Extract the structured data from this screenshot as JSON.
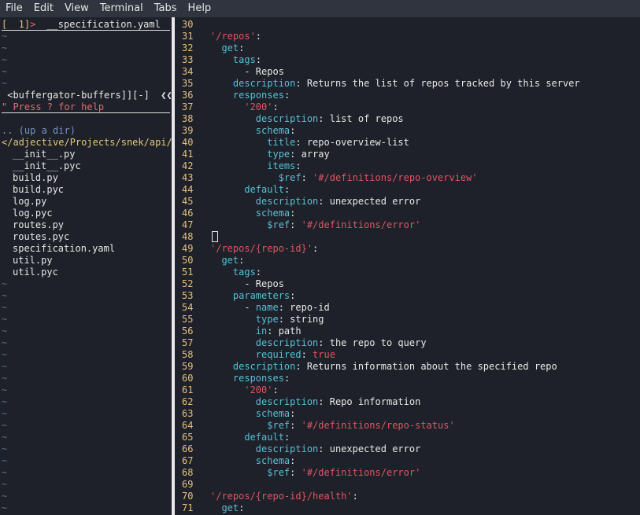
{
  "menu": [
    "File",
    "Edit",
    "View",
    "Terminal",
    "Tabs",
    "Help"
  ],
  "left": {
    "file_tab_bracket": "[  1]",
    "file_tab_arrow": ">",
    "file_tab_name": "__specification.yaml",
    "tilde": "~",
    "buffergator_status": " <buffergator-buffers]][-]  ",
    "buffergator_arrows": "❮❮❮",
    "help_hint": "\" Press ? for help",
    "up_dir": ".. (up a dir)",
    "cwd": "</adjective/Projects/snek/api/",
    "files": [
      "__init__.py",
      "__init__.pyc",
      "build.py",
      "build.pyc",
      "log.py",
      "log.pyc",
      "routes.py",
      "routes.pyc",
      "specification.yaml",
      "util.py",
      "util.pyc"
    ]
  },
  "editor": {
    "lines": [
      {
        "n": "30",
        "indent": "",
        "parts": []
      },
      {
        "n": "31",
        "indent": "",
        "parts": [
          {
            "t": "str",
            "v": "'/repos'"
          },
          {
            "t": "plain",
            "v": ":"
          }
        ]
      },
      {
        "n": "32",
        "indent": "  ",
        "parts": [
          {
            "t": "key",
            "v": "get"
          },
          {
            "t": "plain",
            "v": ":"
          }
        ]
      },
      {
        "n": "33",
        "indent": "    ",
        "parts": [
          {
            "t": "key",
            "v": "tags"
          },
          {
            "t": "plain",
            "v": ":"
          }
        ]
      },
      {
        "n": "34",
        "indent": "      ",
        "parts": [
          {
            "t": "plain",
            "v": "- Repos"
          }
        ]
      },
      {
        "n": "35",
        "indent": "    ",
        "parts": [
          {
            "t": "key",
            "v": "description"
          },
          {
            "t": "plain",
            "v": ": Returns the list of repos tracked by this server"
          }
        ]
      },
      {
        "n": "36",
        "indent": "    ",
        "parts": [
          {
            "t": "key",
            "v": "responses"
          },
          {
            "t": "plain",
            "v": ":"
          }
        ]
      },
      {
        "n": "37",
        "indent": "      ",
        "parts": [
          {
            "t": "str",
            "v": "'200'"
          },
          {
            "t": "plain",
            "v": ":"
          }
        ]
      },
      {
        "n": "38",
        "indent": "        ",
        "parts": [
          {
            "t": "key",
            "v": "description"
          },
          {
            "t": "plain",
            "v": ": list of repos"
          }
        ]
      },
      {
        "n": "39",
        "indent": "        ",
        "parts": [
          {
            "t": "key",
            "v": "schema"
          },
          {
            "t": "plain",
            "v": ":"
          }
        ]
      },
      {
        "n": "40",
        "indent": "          ",
        "parts": [
          {
            "t": "key",
            "v": "title"
          },
          {
            "t": "plain",
            "v": ": repo-overview-list"
          }
        ]
      },
      {
        "n": "41",
        "indent": "          ",
        "parts": [
          {
            "t": "key",
            "v": "type"
          },
          {
            "t": "plain",
            "v": ": array"
          }
        ]
      },
      {
        "n": "42",
        "indent": "          ",
        "parts": [
          {
            "t": "key",
            "v": "items"
          },
          {
            "t": "plain",
            "v": ":"
          }
        ]
      },
      {
        "n": "43",
        "indent": "            ",
        "parts": [
          {
            "t": "key",
            "v": "$ref"
          },
          {
            "t": "plain",
            "v": ": "
          },
          {
            "t": "str",
            "v": "'#/definitions/repo-overview'"
          }
        ]
      },
      {
        "n": "44",
        "indent": "      ",
        "parts": [
          {
            "t": "key",
            "v": "default"
          },
          {
            "t": "plain",
            "v": ":"
          }
        ]
      },
      {
        "n": "45",
        "indent": "        ",
        "parts": [
          {
            "t": "key",
            "v": "description"
          },
          {
            "t": "plain",
            "v": ": unexpected error"
          }
        ]
      },
      {
        "n": "46",
        "indent": "        ",
        "parts": [
          {
            "t": "key",
            "v": "schema"
          },
          {
            "t": "plain",
            "v": ":"
          }
        ]
      },
      {
        "n": "47",
        "indent": "          ",
        "parts": [
          {
            "t": "key",
            "v": "$ref"
          },
          {
            "t": "plain",
            "v": ": "
          },
          {
            "t": "str",
            "v": "'#/definitions/error'"
          }
        ]
      },
      {
        "n": "48",
        "indent": "",
        "parts": [],
        "cursor": true
      },
      {
        "n": "49",
        "indent": "",
        "parts": [
          {
            "t": "str",
            "v": "'/repos/{repo-id}'"
          },
          {
            "t": "plain",
            "v": ":"
          }
        ]
      },
      {
        "n": "50",
        "indent": "  ",
        "parts": [
          {
            "t": "key",
            "v": "get"
          },
          {
            "t": "plain",
            "v": ":"
          }
        ]
      },
      {
        "n": "51",
        "indent": "    ",
        "parts": [
          {
            "t": "key",
            "v": "tags"
          },
          {
            "t": "plain",
            "v": ":"
          }
        ]
      },
      {
        "n": "52",
        "indent": "      ",
        "parts": [
          {
            "t": "plain",
            "v": "- Repos"
          }
        ]
      },
      {
        "n": "53",
        "indent": "    ",
        "parts": [
          {
            "t": "key",
            "v": "parameters"
          },
          {
            "t": "plain",
            "v": ":"
          }
        ]
      },
      {
        "n": "54",
        "indent": "      ",
        "parts": [
          {
            "t": "plain",
            "v": "- "
          },
          {
            "t": "key",
            "v": "name"
          },
          {
            "t": "plain",
            "v": ": repo-id"
          }
        ]
      },
      {
        "n": "55",
        "indent": "        ",
        "parts": [
          {
            "t": "key",
            "v": "type"
          },
          {
            "t": "plain",
            "v": ": string"
          }
        ]
      },
      {
        "n": "56",
        "indent": "        ",
        "parts": [
          {
            "t": "key",
            "v": "in"
          },
          {
            "t": "plain",
            "v": ": path"
          }
        ]
      },
      {
        "n": "57",
        "indent": "        ",
        "parts": [
          {
            "t": "key",
            "v": "description"
          },
          {
            "t": "plain",
            "v": ": the repo to query"
          }
        ]
      },
      {
        "n": "58",
        "indent": "        ",
        "parts": [
          {
            "t": "key",
            "v": "required"
          },
          {
            "t": "plain",
            "v": ": "
          },
          {
            "t": "bool",
            "v": "true"
          }
        ]
      },
      {
        "n": "59",
        "indent": "    ",
        "parts": [
          {
            "t": "key",
            "v": "description"
          },
          {
            "t": "plain",
            "v": ": Returns information about the specified repo"
          }
        ]
      },
      {
        "n": "60",
        "indent": "    ",
        "parts": [
          {
            "t": "key",
            "v": "responses"
          },
          {
            "t": "plain",
            "v": ":"
          }
        ]
      },
      {
        "n": "61",
        "indent": "      ",
        "parts": [
          {
            "t": "str",
            "v": "'200'"
          },
          {
            "t": "plain",
            "v": ":"
          }
        ]
      },
      {
        "n": "62",
        "indent": "        ",
        "parts": [
          {
            "t": "key",
            "v": "description"
          },
          {
            "t": "plain",
            "v": ": Repo information"
          }
        ]
      },
      {
        "n": "63",
        "indent": "        ",
        "parts": [
          {
            "t": "key",
            "v": "schema"
          },
          {
            "t": "plain",
            "v": ":"
          }
        ]
      },
      {
        "n": "64",
        "indent": "          ",
        "parts": [
          {
            "t": "key",
            "v": "$ref"
          },
          {
            "t": "plain",
            "v": ": "
          },
          {
            "t": "str",
            "v": "'#/definitions/repo-status'"
          }
        ]
      },
      {
        "n": "65",
        "indent": "      ",
        "parts": [
          {
            "t": "key",
            "v": "default"
          },
          {
            "t": "plain",
            "v": ":"
          }
        ]
      },
      {
        "n": "66",
        "indent": "        ",
        "parts": [
          {
            "t": "key",
            "v": "description"
          },
          {
            "t": "plain",
            "v": ": unexpected error"
          }
        ]
      },
      {
        "n": "67",
        "indent": "        ",
        "parts": [
          {
            "t": "key",
            "v": "schema"
          },
          {
            "t": "plain",
            "v": ":"
          }
        ]
      },
      {
        "n": "68",
        "indent": "          ",
        "parts": [
          {
            "t": "key",
            "v": "$ref"
          },
          {
            "t": "plain",
            "v": ": "
          },
          {
            "t": "str",
            "v": "'#/definitions/error'"
          }
        ]
      },
      {
        "n": "69",
        "indent": "",
        "parts": []
      },
      {
        "n": "70",
        "indent": "",
        "parts": [
          {
            "t": "str",
            "v": "'/repos/{repo-id}/health'"
          },
          {
            "t": "plain",
            "v": ":"
          }
        ]
      },
      {
        "n": "71",
        "indent": "  ",
        "parts": [
          {
            "t": "key",
            "v": "get"
          },
          {
            "t": "plain",
            "v": ":"
          }
        ]
      }
    ]
  },
  "colors": {
    "background": "#1e2129",
    "menubar": "#2f343f",
    "line_number": "#e5c07b",
    "key": "#56c0d6",
    "string": "#e05561",
    "tilde": "#5f6f8a"
  }
}
